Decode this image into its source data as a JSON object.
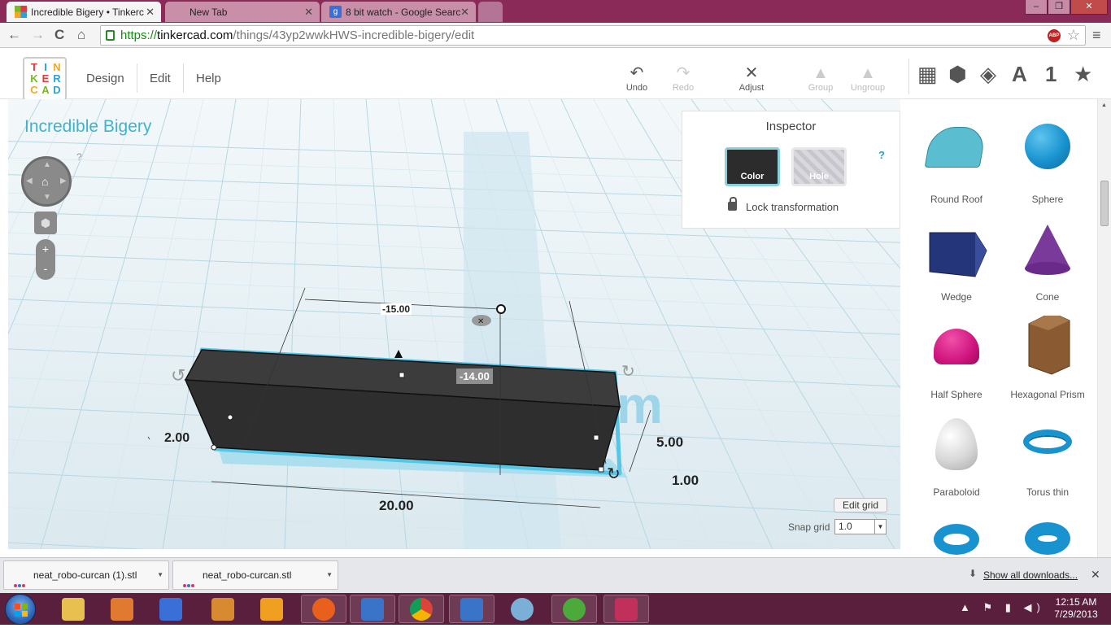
{
  "browser": {
    "tabs": [
      {
        "title": "Incredible Bigery • Tinkerc",
        "active": true
      },
      {
        "title": "New Tab",
        "active": false
      },
      {
        "title": "8 bit watch - Google Searc",
        "active": false
      }
    ],
    "url_scheme": "https://",
    "url_host": "tinkercad.com",
    "url_path": "/things/43yp2wwkHWS-incredible-bigery/edit",
    "window_controls": {
      "minimize": "–",
      "maximize": "❐",
      "close": "✕"
    },
    "nav": {
      "back": "←",
      "forward": "→",
      "reload": "C",
      "home": "⌂",
      "star": "☆",
      "menu": "≡"
    },
    "ext_badge": "ABP"
  },
  "app": {
    "logo_letters": [
      "T",
      "I",
      "N",
      "K",
      "E",
      "R",
      "C",
      "A",
      "D"
    ],
    "logo_colors": [
      "#e03a3a",
      "#2f9fd8",
      "#f5a623",
      "#7ab829",
      "#e03a3a",
      "#2f9fd8",
      "#f5a623",
      "#7ab829",
      "#2f9fd8"
    ],
    "menu": {
      "design": "Design",
      "edit": "Edit",
      "help": "Help"
    },
    "toolbar": {
      "undo": {
        "label": "Undo",
        "icon": "↶"
      },
      "redo": {
        "label": "Redo",
        "icon": "↷"
      },
      "adjust": {
        "label": "Adjust",
        "icon": "✕"
      },
      "group": {
        "label": "Group",
        "icon": "▲"
      },
      "ungroup": {
        "label": "Ungroup",
        "icon": "▲"
      }
    },
    "view_icons": {
      "grid": "▦",
      "box": "⬢",
      "wire": "◈",
      "letter": "A",
      "number": "1",
      "star": "★"
    }
  },
  "workplane": {
    "title": "Incredible Bigery",
    "help": "?",
    "zoom_in": "+",
    "zoom_out": "-",
    "dimensions": {
      "top_offset": "-15.00",
      "height_marker": "-14.00",
      "left_width": "2.00",
      "height": "5.00",
      "elevation": "1.00",
      "length": "20.00"
    },
    "edit_grid": "Edit grid",
    "snap_label": "Snap grid",
    "snap_value": "1.0",
    "snap_caret": "▼"
  },
  "inspector": {
    "title": "Inspector",
    "help": "?",
    "color_label": "Color",
    "hole_label": "Hole",
    "lock_label": "Lock transformation",
    "selected_color": "#2c2c2c"
  },
  "shapes": [
    {
      "name": "Round Roof",
      "color": "#5bbdd0"
    },
    {
      "name": "Sphere",
      "color": "#1993cf"
    },
    {
      "name": "Wedge",
      "color": "#24357a"
    },
    {
      "name": "Cone",
      "color": "#7a3a9a"
    },
    {
      "name": "Half Sphere",
      "color": "#d0157f"
    },
    {
      "name": "Hexagonal Prism",
      "color": "#8a5a32"
    },
    {
      "name": "Paraboloid",
      "color": "#d8d8d8"
    },
    {
      "name": "Torus thin",
      "color": "#1993cf"
    },
    {
      "name": "",
      "color": "#1993cf"
    },
    {
      "name": "",
      "color": "#1993cf"
    }
  ],
  "downloads": {
    "items": [
      "neat_robo-curcan (1).stl",
      "neat_robo-curcan.stl"
    ],
    "show_all": "Show all downloads...",
    "close": "✕"
  },
  "taskbar": {
    "time": "12:15 AM",
    "date": "7/29/2013",
    "tray": "▲ ⚑ ▮ ◀)",
    "apps": [
      {
        "name": "explorer",
        "color": "#e8c050"
      },
      {
        "name": "paint-app",
        "color": "#e07a30"
      },
      {
        "name": "wizard",
        "color": "#3a6fd8"
      },
      {
        "name": "game",
        "color": "#d88a30"
      },
      {
        "name": "media-player",
        "color": "#f0a020"
      },
      {
        "name": "firefox",
        "color": "#e8601c"
      },
      {
        "name": "word-doc",
        "color": "#3a74c8"
      },
      {
        "name": "chrome",
        "color": "#3aa048"
      },
      {
        "name": "word-doc-2",
        "color": "#3a74c8"
      },
      {
        "name": "paint",
        "color": "#7ab0d8"
      },
      {
        "name": "utorrent",
        "color": "#4caa3a"
      },
      {
        "name": "tinkercad-app",
        "color": "#c0305a"
      }
    ]
  }
}
